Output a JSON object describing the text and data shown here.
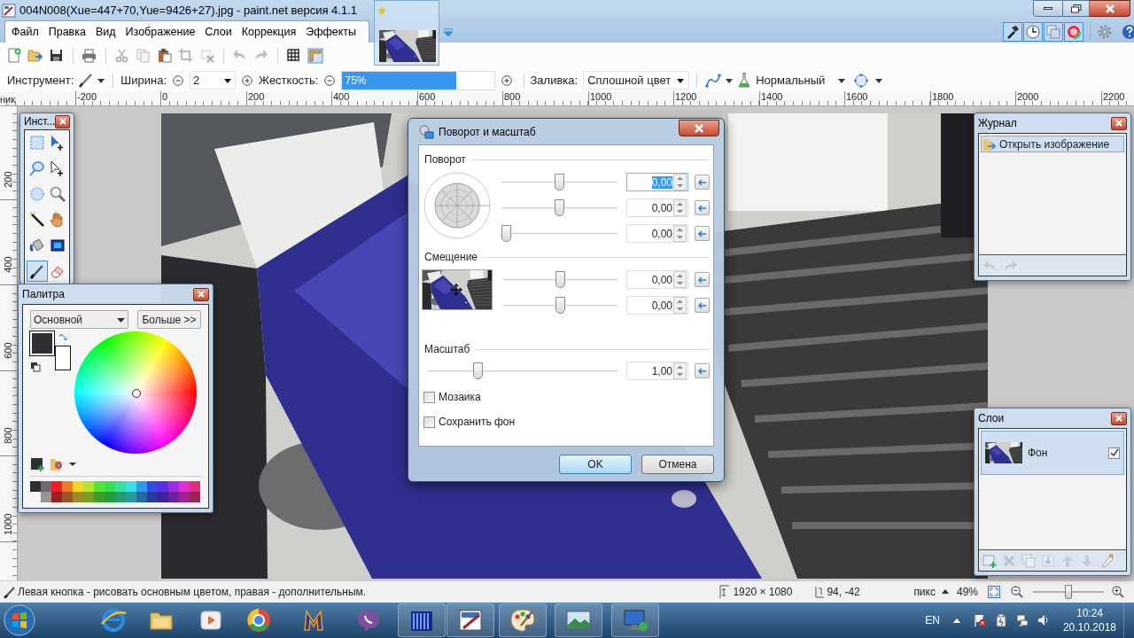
{
  "window": {
    "title": "004N008(Xue=447+70,Yue=9426+27).jpg - paint.net версия 4.1.1"
  },
  "menu": [
    "Файл",
    "Правка",
    "Вид",
    "Изображение",
    "Слои",
    "Коррекция",
    "Эффекты"
  ],
  "panel_toggles": [
    {
      "selected": true
    },
    {
      "selected": true
    },
    {
      "selected": true
    },
    {
      "selected": true
    }
  ],
  "tool_options": {
    "tool_label": "Инструмент:",
    "width_label": "Ширина:",
    "width_value": "2",
    "hardness_label": "Жесткость:",
    "hardness": {
      "reading": "75%",
      "level": 0.75
    },
    "fill_label": "Заливка:",
    "fill_value": "Сплошной цвет",
    "blend_mode": "Нормальный"
  },
  "ruler": {
    "unit_fragment": "ник",
    "x_labels": [
      "-200",
      "0",
      "200",
      "400",
      "600",
      "800",
      "1000",
      "1200",
      "1400",
      "1600",
      "1800",
      "2000",
      "2200"
    ],
    "y_labels": [
      "200",
      "400",
      "600",
      "800",
      "1000"
    ]
  },
  "tools_window": {
    "title": "Инст...",
    "tools": [
      {
        "selected": false
      },
      {
        "selected": false
      },
      {
        "selected": false
      },
      {
        "selected": false
      },
      {
        "selected": false
      },
      {
        "selected": false
      },
      {
        "selected": false
      },
      {
        "selected": false
      },
      {
        "selected": false
      },
      {
        "selected": false
      },
      {
        "selected": true
      },
      {
        "selected": false
      }
    ]
  },
  "palette_window": {
    "title": "Палитра",
    "mode": "Основной",
    "more_button": "Больше >>",
    "primary": {
      "color": "#2e3033"
    },
    "secondary": {
      "color": "#ffffff"
    },
    "swatches_top": [
      {
        "color": "#303030"
      },
      {
        "color": "#6b6b6b"
      },
      {
        "color": "#ed2027"
      },
      {
        "color": "#f07b28"
      },
      {
        "color": "#f5d327"
      },
      {
        "color": "#b5e235"
      },
      {
        "color": "#5de03a"
      },
      {
        "color": "#34e04e"
      },
      {
        "color": "#35e09b"
      },
      {
        "color": "#38e2e2"
      },
      {
        "color": "#2e9be6"
      },
      {
        "color": "#2e4fe0"
      },
      {
        "color": "#5b2fe0"
      },
      {
        "color": "#9b2fe0"
      },
      {
        "color": "#e02fd6"
      },
      {
        "color": "#e02f7a"
      }
    ],
    "swatches_bottom": [
      {
        "color": "#959595"
      },
      {
        "color": "#9b2026"
      },
      {
        "color": "#9b5526"
      },
      {
        "color": "#9b8a26"
      },
      {
        "color": "#7a9b26"
      },
      {
        "color": "#3f9b28"
      },
      {
        "color": "#259b35"
      },
      {
        "color": "#279b6b"
      },
      {
        "color": "#279b9b"
      },
      {
        "color": "#26699b"
      },
      {
        "color": "#26389b"
      },
      {
        "color": "#3e239b"
      },
      {
        "color": "#6a239b"
      },
      {
        "color": "#9b2394"
      },
      {
        "color": "#9b2355"
      }
    ]
  },
  "dialog": {
    "title": "Поворот и масштаб",
    "sections": [
      {
        "label": "Поворот",
        "kind": "dial",
        "sliders": [
          {
            "level": 0.5,
            "value": "0,00",
            "text_selected": true
          },
          {
            "level": 0.5,
            "value": "0,00",
            "text_selected": false
          },
          {
            "level": 0,
            "value": "0,00",
            "text_selected": false
          }
        ]
      },
      {
        "label": "Смещение",
        "kind": "pan",
        "sliders": [
          {
            "level": 0.5,
            "value": "0,00",
            "text_selected": false
          },
          {
            "level": 0.5,
            "value": "0,00",
            "text_selected": false
          }
        ]
      },
      {
        "label": "Масштаб",
        "kind": "plain",
        "sliders": [
          {
            "level": 0.25,
            "value": "1,00",
            "text_selected": false
          }
        ]
      }
    ],
    "checkboxes": [
      {
        "label": "Мозаика",
        "checked": false
      },
      {
        "label": "Сохранить фон",
        "checked": false
      }
    ],
    "buttons": [
      {
        "label": "OK",
        "default": true
      },
      {
        "label": "Отмена",
        "default": false
      }
    ]
  },
  "history": {
    "title": "Журнал",
    "items": [
      {
        "label": "Открыть изображение",
        "selected": true
      }
    ]
  },
  "layers": {
    "title": "Слои",
    "items": [
      {
        "name": "Фон",
        "visible": true,
        "selected": true
      }
    ]
  },
  "status_bar": {
    "hint": "Левая кнопка - рисовать основным цветом, правая - дополнительным.",
    "size": "1920 × 1080",
    "position": "94, -42",
    "unit": "пикс",
    "zoom": "49%",
    "zoom_slider": {
      "level": 0.5
    }
  },
  "taskbar": {
    "language": "EN",
    "time": "10:24",
    "date": "20.10.2018"
  }
}
